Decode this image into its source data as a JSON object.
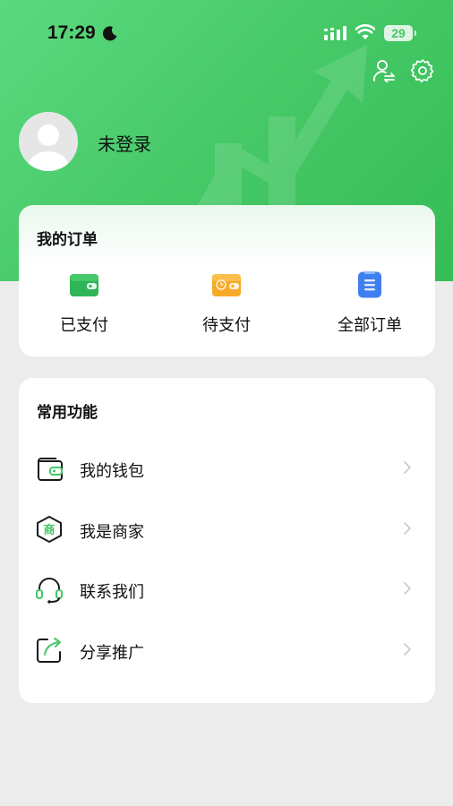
{
  "status_bar": {
    "time": "17:29",
    "battery": "29",
    "icons": [
      "moon-icon",
      "signal-icon",
      "wifi-icon",
      "battery-icon"
    ]
  },
  "header": {
    "actions": [
      "switch-account-icon",
      "settings-icon"
    ],
    "colors": {
      "gradient_start": "#5cd97f",
      "gradient_end": "#35bd55"
    }
  },
  "profile": {
    "username": "未登录",
    "avatar": "default-avatar-icon"
  },
  "orders": {
    "title": "我的订单",
    "items": [
      {
        "label": "已支付",
        "icon": "wallet-green-icon"
      },
      {
        "label": "待支付",
        "icon": "wallet-clock-orange-icon"
      },
      {
        "label": "全部订单",
        "icon": "list-blue-icon"
      }
    ]
  },
  "functions": {
    "title": "常用功能",
    "items": [
      {
        "label": "我的钱包",
        "icon": "wallet-icon"
      },
      {
        "label": "我是商家",
        "icon": "merchant-icon",
        "icon_text": "商"
      },
      {
        "label": "联系我们",
        "icon": "headset-icon"
      },
      {
        "label": "分享推广",
        "icon": "share-icon"
      }
    ]
  },
  "colors": {
    "accent": "#44c765",
    "orange": "#f7a928",
    "blue": "#3f7ff0",
    "page_bg": "#ececec"
  }
}
